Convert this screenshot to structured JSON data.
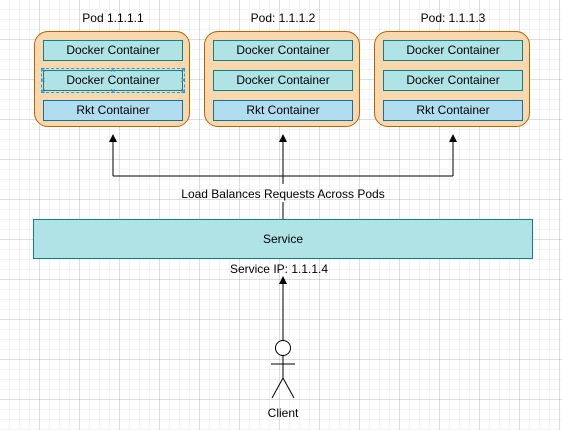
{
  "pods": [
    {
      "title": "Pod 1.1.1.1",
      "containers": [
        "Docker Container",
        "Docker Container",
        "Rkt Container"
      ]
    },
    {
      "title": "Pod: 1.1.1.2",
      "containers": [
        "Docker Container",
        "Docker Container",
        "Rkt Container"
      ]
    },
    {
      "title": "Pod: 1.1.1.3",
      "containers": [
        "Docker Container",
        "Docker Container",
        "Rkt Container"
      ]
    }
  ],
  "load_balance_label": "Load Balances Requests Across Pods",
  "service": {
    "label": "Service",
    "ip_label": "Service IP: 1.1.1.4"
  },
  "client": {
    "label": "Client"
  },
  "colors": {
    "pod_fill": "#fad7ac",
    "pod_stroke": "#b46504",
    "docker_fill": "#b0e3e6",
    "rkt_fill": "#b1ddf0",
    "service_fill": "#b0e3e6"
  }
}
